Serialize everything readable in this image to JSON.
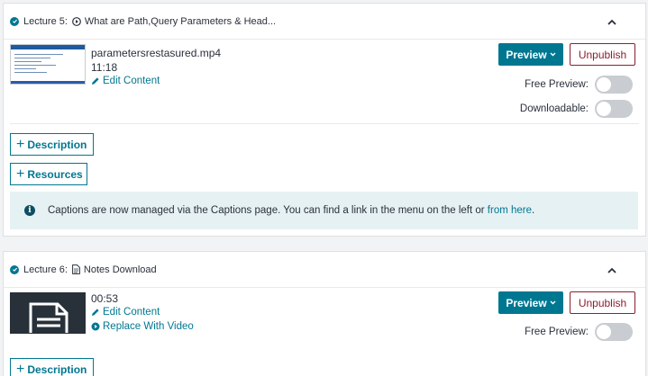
{
  "colors": {
    "accent": "#007791",
    "danger": "#8b1f30",
    "toggle_off": "#c9ccd0",
    "notice_bg": "#e6f1f3"
  },
  "lectures": [
    {
      "number_label": "Lecture 5:",
      "type_icon": "play-circle-icon",
      "title": "What are Path,Query Parameters & Head...",
      "file_name": "parametersrestasured.mp4",
      "duration": "11:18",
      "edit_label": "Edit Content",
      "preview_label": "Preview",
      "unpublish_label": "Unpublish",
      "free_preview_label": "Free Preview:",
      "downloadable_label": "Downloadable:",
      "description_label": "Description",
      "resources_label": "Resources",
      "notice_text": "Captions are now managed via the Captions page. You can find a link in the menu on the left or ",
      "notice_link": "from here",
      "notice_end": "."
    },
    {
      "number_label": "Lecture 6:",
      "type_icon": "document-icon",
      "title": "Notes Download",
      "duration": "00:53",
      "edit_label": "Edit Content",
      "replace_label": "Replace With Video",
      "preview_label": "Preview",
      "unpublish_label": "Unpublish",
      "free_preview_label": "Free Preview:",
      "description_label": "Description"
    }
  ]
}
